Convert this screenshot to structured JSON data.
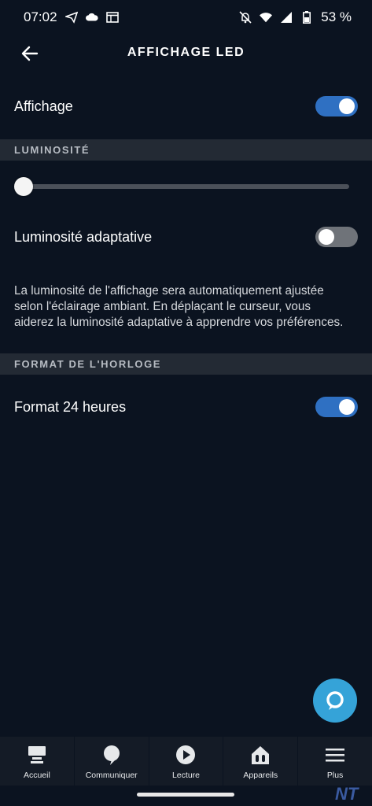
{
  "status_bar": {
    "time": "07:02",
    "battery": "53 %",
    "left_icons": [
      "telegram-icon",
      "cloud-icon",
      "window-icon"
    ],
    "right_icons": [
      "bell-off-icon",
      "wifi-icon",
      "signal-icon",
      "battery-icon"
    ]
  },
  "header": {
    "title": "AFFICHAGE LED",
    "back_icon": "arrow-left-icon"
  },
  "settings": {
    "display": {
      "label": "Affichage",
      "on": true
    },
    "brightness_section": "LUMINOSITÉ",
    "brightness_slider": {
      "value_fraction": 0.0
    },
    "adaptive": {
      "label": "Luminosité adaptative",
      "on": false
    },
    "description": "La luminosité de l'affichage sera automatiquement ajustée selon l'éclairage ambiant. En déplaçant le curseur, vous aiderez la luminosité adaptative à apprendre vos préférences.",
    "clock_section": "FORMAT DE L'HORLOGE",
    "format24": {
      "label": "Format 24 heures",
      "on": true
    }
  },
  "fab": {
    "icon": "alexa-icon"
  },
  "nav": [
    {
      "label": "Accueil",
      "icon": "home-icon"
    },
    {
      "label": "Communiquer",
      "icon": "chat-bubble-icon"
    },
    {
      "label": "Lecture",
      "icon": "play-icon"
    },
    {
      "label": "Appareils",
      "icon": "devices-icon"
    },
    {
      "label": "Plus",
      "icon": "menu-icon"
    }
  ],
  "watermark": "NT",
  "colors": {
    "background": "#0b1320",
    "toggle_on": "#2f70c2",
    "toggle_off": "#6f7379",
    "section_bg": "#232a34",
    "fab": "#35a3d8"
  }
}
